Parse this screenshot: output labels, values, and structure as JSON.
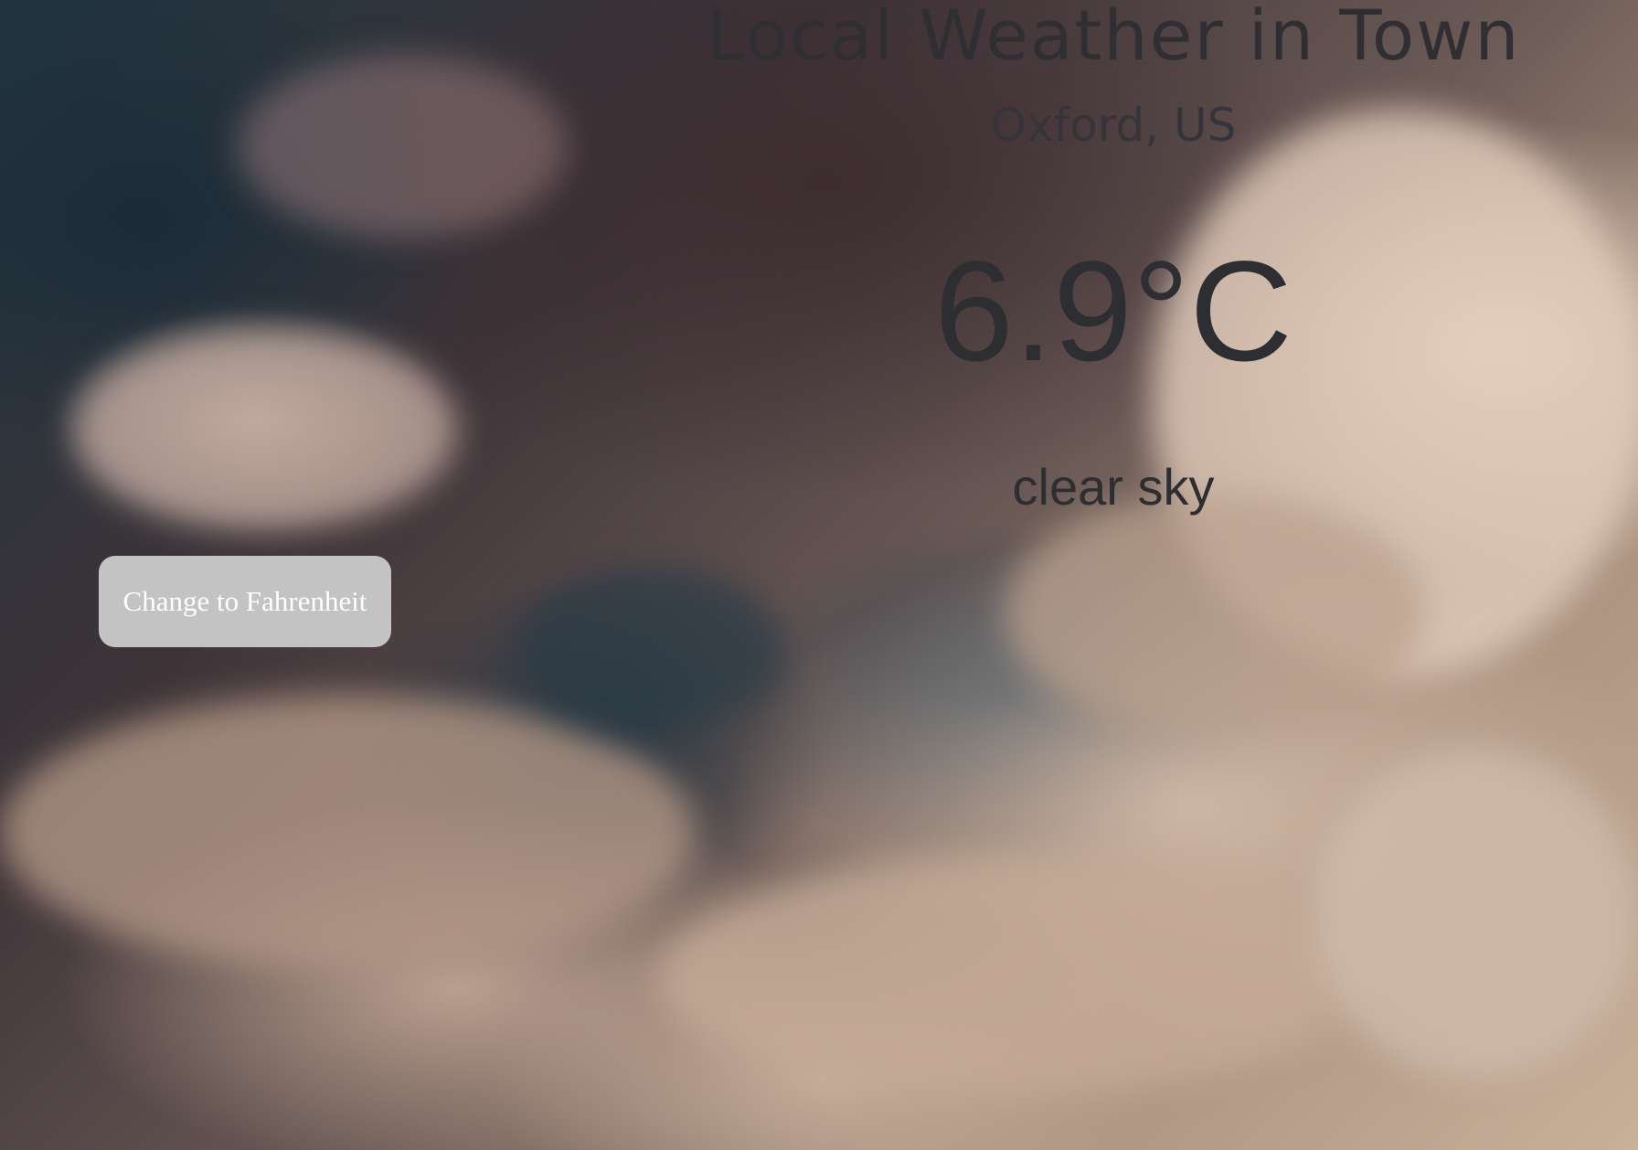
{
  "header": {
    "title": "Local Weather in Town"
  },
  "weather": {
    "location": "Oxford, US",
    "temperature": "6.9°C",
    "description": "clear sky"
  },
  "controls": {
    "toggle_unit_label": "Change to Fahrenheit"
  }
}
